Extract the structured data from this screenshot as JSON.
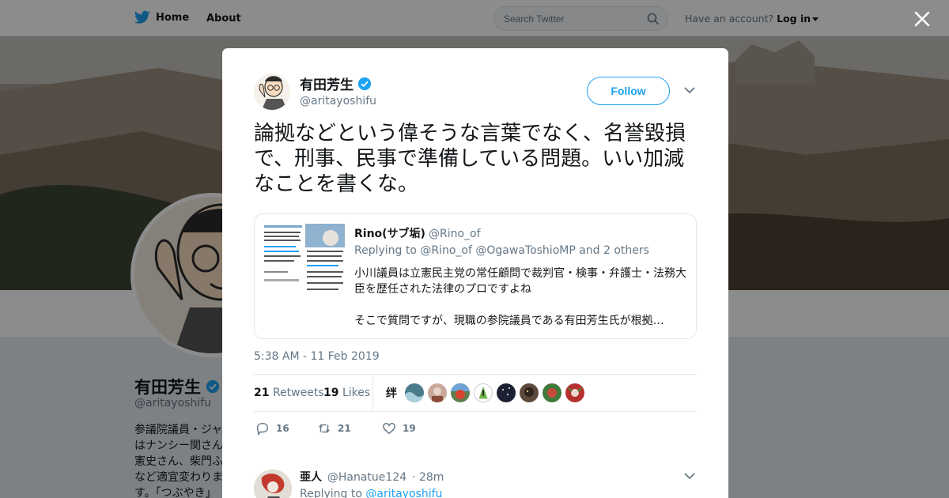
{
  "nav": {
    "home_label": "Home",
    "about_label": "About",
    "search_placeholder": "Search Twitter",
    "account_prompt": "Have an account?",
    "login_label": "Log in"
  },
  "profile": {
    "name": "有田芳生",
    "handle": "@aritayoshifu",
    "bio": "参議院議員・ジャ\nはナンシー関さん\n憲史さん、柴門ふ\nなど適宜変わりま\nす。「つぶやき」"
  },
  "tweet": {
    "author_name": "有田芳生",
    "author_handle": "@aritayoshifu",
    "follow_label": "Follow",
    "text": "論拠などという偉そうな言葉でなく、名誉毀損で、刑事、民事で準備している問題。いい加減なことを書くな。",
    "timestamp": "5:38 AM - 11 Feb 2019",
    "retweets_count": "21",
    "retweets_label": "Retweets",
    "likes_count": "19",
    "likes_label": "Likes",
    "replies_action_count": "16",
    "retweets_action_count": "21",
    "likes_action_count": "19"
  },
  "quote": {
    "name": "Rino(サブ垢)",
    "handle": "@Rino_of",
    "replying_to": "Replying to @Rino_of @OgawaToshioMP and 2 others",
    "body": "小川議員は立憲民主党の常任顧問で裁判官・検事・弁護士・法務大臣を歴任された法律のプロですよね\n\nそこで質問ですが、現職の参院議員である有田芳生氏が根拠…"
  },
  "likers": [
    {
      "glyph": "绊",
      "color": "#ffffff"
    },
    {
      "glyph": "",
      "color": "#4a7c8c"
    },
    {
      "glyph": "",
      "color": "#c9a79a"
    },
    {
      "glyph": "",
      "color": "#5d7f4f"
    },
    {
      "glyph": "",
      "color": "#ffffff"
    },
    {
      "glyph": "",
      "color": "#1c2033"
    },
    {
      "glyph": "",
      "color": "#5b4a3a"
    },
    {
      "glyph": "",
      "color": "#3f7a3a"
    },
    {
      "glyph": "",
      "color": "#b5302e"
    }
  ],
  "reply": {
    "name": "亜人",
    "handle": "@Hanatue124",
    "time": "· 28m",
    "replying_prefix": "Replying to",
    "replying_handle": "@aritayoshifu"
  },
  "colors": {
    "brand": "#1da1f2",
    "text": "#14171a",
    "muted": "#657786"
  }
}
